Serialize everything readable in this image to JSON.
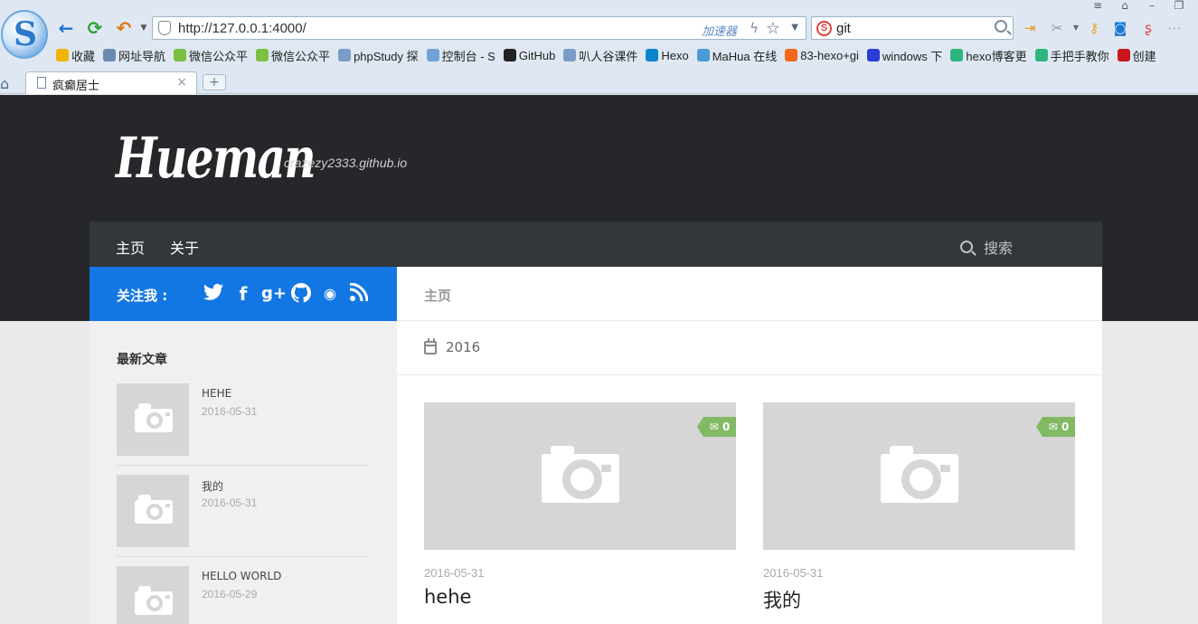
{
  "browser": {
    "url": "http://127.0.0.1:4000/",
    "accelerator_label": "加速器",
    "search_value": "git",
    "bookmarks": [
      {
        "label": "收藏",
        "icon": "star-icon",
        "color": "#f0b400"
      },
      {
        "label": "网址导航",
        "icon": "globe-icon",
        "color": "#6a8ab0"
      },
      {
        "label": "微信公众平",
        "icon": "wechat-icon",
        "color": "#7bc043"
      },
      {
        "label": "微信公众平",
        "icon": "wechat-icon",
        "color": "#7bc043"
      },
      {
        "label": "phpStudy 探",
        "icon": "page-icon",
        "color": "#7a9cc6"
      },
      {
        "label": "控制台 - S",
        "icon": "cloud-icon",
        "color": "#6fa3d6"
      },
      {
        "label": "GitHub",
        "icon": "github-icon",
        "color": "#222222"
      },
      {
        "label": "叭人谷课件",
        "icon": "page-icon",
        "color": "#7a9cc6"
      },
      {
        "label": "Hexo",
        "icon": "hexo-icon",
        "color": "#0e83cd"
      },
      {
        "label": "MaHua 在线",
        "icon": "mahua-icon",
        "color": "#4a9ad6"
      },
      {
        "label": "83-hexo+gi",
        "icon": "smile-icon",
        "color": "#f06a1a"
      },
      {
        "label": "windows 下",
        "icon": "paw-icon",
        "color": "#2a3bd6"
      },
      {
        "label": "hexo博客更",
        "icon": "leaf-icon",
        "color": "#2cb67d"
      },
      {
        "label": "手把手教你",
        "icon": "leaf-icon",
        "color": "#2cb67d"
      },
      {
        "label": "创建",
        "icon": "c-icon",
        "color": "#c8161d"
      }
    ],
    "tab_title": "疯癫居士",
    "tab_close": "×",
    "new_tab": "+"
  },
  "site": {
    "title": "Hueman",
    "description": "crazezy2333.github.io",
    "nav": [
      "主页",
      "关于"
    ],
    "search_label": "搜索",
    "follow_label": "关注我 :",
    "social_icons": [
      "twitter-icon",
      "facebook-icon",
      "google-plus-icon",
      "github-icon",
      "weibo-icon",
      "rss-icon"
    ],
    "breadcrumb": "主页",
    "archive_year": "2016"
  },
  "sidebar": {
    "recent_title": "最新文章",
    "posts": [
      {
        "title": "HEHE",
        "date": "2016-05-31"
      },
      {
        "title": "我的",
        "date": "2016-05-31"
      },
      {
        "title": "HELLO WORLD",
        "date": "2016-05-29"
      }
    ]
  },
  "cards": [
    {
      "comments": "0",
      "date": "2016-05-31",
      "title": "hehe"
    },
    {
      "comments": "0",
      "date": "2016-05-31",
      "title": "我的"
    }
  ],
  "colors": {
    "header_bg": "#26272b",
    "nav_bg": "#33363b",
    "follow_bg": "#1377e3",
    "badge_bg": "#82b965"
  }
}
